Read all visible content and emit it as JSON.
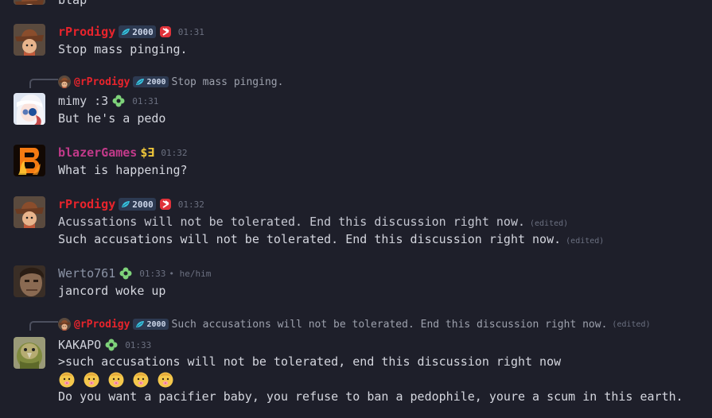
{
  "partial_top": {
    "text": "blap"
  },
  "tag_label": "2000",
  "messages": [
    {
      "author": "rProdigy",
      "time": "01:31",
      "lines": [
        "Stop mass pinging."
      ]
    },
    {
      "reply": {
        "author": "@rProdigy",
        "tag": "2000",
        "text": "Stop mass pinging."
      },
      "author": "mimy :3",
      "time": "01:31",
      "lines": [
        "But he's a pedo"
      ]
    },
    {
      "author": "blazerGames",
      "tag_text": "$∃",
      "time": "01:32",
      "lines": [
        "What is happening?"
      ]
    },
    {
      "author": "rProdigy",
      "time": "01:32",
      "lines": [
        "Acussations will not be tolerated. End this discussion right now.",
        "Such accusations will not be tolerated. End this discussion right now."
      ],
      "edited": "(edited)"
    },
    {
      "author": "Werto761",
      "time": "01:33",
      "pronoun": "• he/him",
      "lines": [
        "jancord woke up"
      ]
    },
    {
      "reply": {
        "author": "@rProdigy",
        "tag": "2000",
        "text": "Such accusations will not be tolerated. End this discussion right now.",
        "edited": "(edited)"
      },
      "author": "KAKAPO",
      "time": "01:33",
      "lines": [
        ">such accusations will not be tolerated, end this discussion right now",
        "Do you want a pacifier baby, you refuse to ban a pedophile, youre a scum in this earth."
      ],
      "emoji_count": 5
    }
  ],
  "colors": {
    "background": "#1e1f2a",
    "prodigy": "#e8242c",
    "text": "#d4d6de",
    "muted": "#6b7080"
  }
}
